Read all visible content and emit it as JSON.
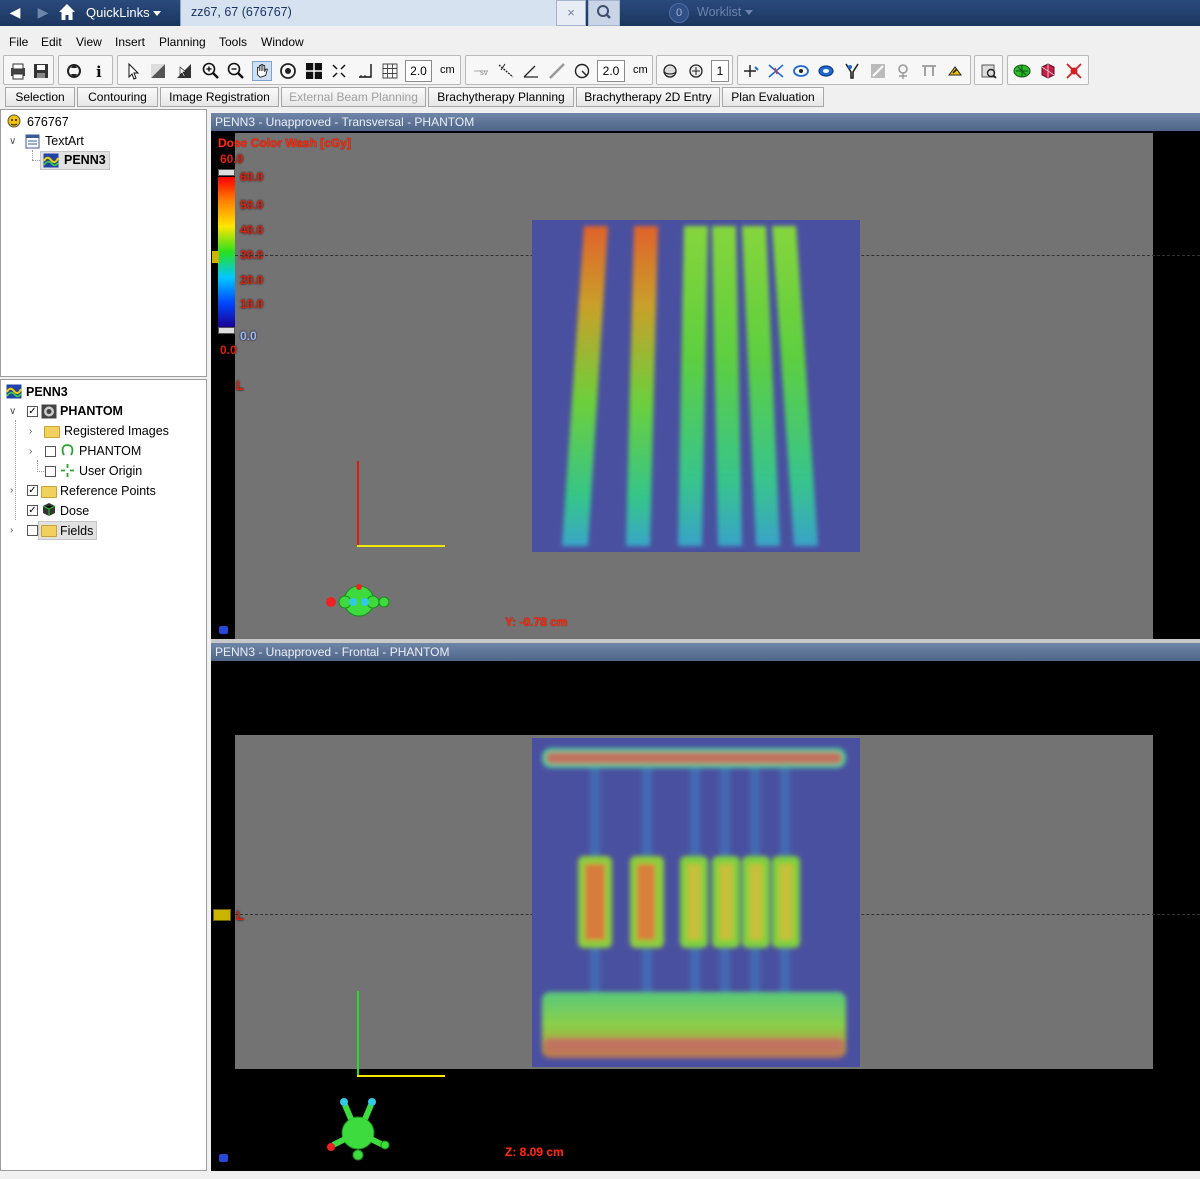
{
  "titlebar": {
    "quicklinks": "QuickLinks",
    "patient_tab": "zz67, 67  (676767)",
    "close": "×",
    "worklist_count": "0",
    "worklist": "Worklist"
  },
  "menu": [
    "File",
    "Edit",
    "View",
    "Insert",
    "Planning",
    "Tools",
    "Window"
  ],
  "toolbar": {
    "grid_value": "2.0",
    "grid_unit": "cm",
    "measure_value": "2.0",
    "measure_unit": "cm",
    "count_value": "1"
  },
  "tabs": [
    {
      "label": "Selection",
      "enabled": true
    },
    {
      "label": "Contouring",
      "enabled": true
    },
    {
      "label": "Image Registration",
      "enabled": true
    },
    {
      "label": "External Beam Planning",
      "enabled": false
    },
    {
      "label": "Brachytherapy Planning",
      "enabled": true
    },
    {
      "label": "Brachytherapy 2D Entry",
      "enabled": true
    },
    {
      "label": "Plan Evaluation",
      "enabled": true
    }
  ],
  "patient_tree": {
    "patient_id": "676767",
    "course": "TextArt",
    "plan": "PENN3"
  },
  "plan_tree": {
    "root": "PENN3",
    "phantom": "PHANTOM",
    "registered_images": "Registered Images",
    "phantom_image": "PHANTOM",
    "user_origin": "User Origin",
    "reference_points": "Reference Points",
    "dose": "Dose",
    "fields": "Fields"
  },
  "viewer_top": {
    "title": "PENN3  -  Unapproved - Transversal - PHANTOM",
    "dose_label": "Dose Color Wash [cGy]",
    "scale_top": "60.0",
    "scale_ticks": [
      "60.0",
      "50.0",
      "40.0",
      "30.0",
      "20.0",
      "10.0"
    ],
    "scale_min_value": "0.0",
    "scale_bottom": "0.0",
    "orientation": "L",
    "coord": "Y: -0.78 cm"
  },
  "viewer_bottom": {
    "title": "PENN3  -  Unapproved - Frontal - PHANTOM",
    "orientation": "L",
    "coord": "Z: 8.09 cm"
  },
  "colors": {
    "titlebar": "#1b365f",
    "viewer_header": "#5a7193",
    "dose_text": "#ff2a0a",
    "phantom_gray": "#737373",
    "dose_blue": "#4a50a0"
  }
}
